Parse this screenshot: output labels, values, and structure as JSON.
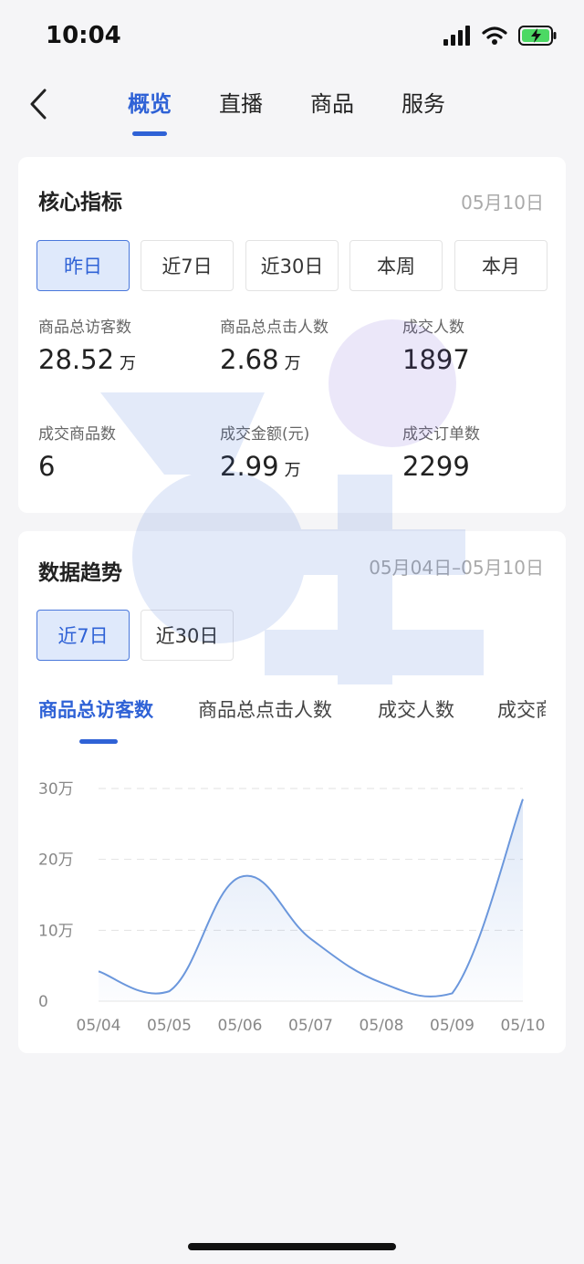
{
  "status_bar": {
    "time": "10:04"
  },
  "nav": {
    "tabs": [
      {
        "label": "概览",
        "active": true
      },
      {
        "label": "直播",
        "active": false
      },
      {
        "label": "商品",
        "active": false
      },
      {
        "label": "服务",
        "active": false
      }
    ]
  },
  "core": {
    "title": "核心指标",
    "date": "05月10日",
    "ranges": [
      "昨日",
      "近7日",
      "近30日",
      "本周",
      "本月"
    ],
    "active_range": 0,
    "metrics": [
      {
        "label": "商品总访客数",
        "value": "28.52",
        "unit": "万"
      },
      {
        "label": "商品总点击人数",
        "value": "2.68",
        "unit": "万"
      },
      {
        "label": "成交人数",
        "value": "1897",
        "unit": ""
      },
      {
        "label": "成交商品数",
        "value": "6",
        "unit": ""
      },
      {
        "label": "成交金额(元)",
        "value": "2.99",
        "unit": "万"
      },
      {
        "label": "成交订单数",
        "value": "2299",
        "unit": ""
      }
    ]
  },
  "trend": {
    "title": "数据趋势",
    "date_range": "05月04日–05月10日",
    "ranges": [
      "近7日",
      "近30日"
    ],
    "active_range": 0,
    "metric_tabs": [
      "商品总访客数",
      "商品总点击人数",
      "成交人数",
      "成交商"
    ],
    "active_metric": 0
  },
  "colors": {
    "accent": "#2f62d6",
    "line": "#6b97dc",
    "active_bg": "#dfe9fb"
  },
  "chart_data": {
    "type": "area",
    "x": [
      "05/04",
      "05/05",
      "05/06",
      "05/07",
      "05/08",
      "05/09",
      "05/10"
    ],
    "series": [
      {
        "values": [
          4.2,
          1.4,
          17.5,
          8.8,
          2.6,
          1.1,
          28.5
        ]
      }
    ],
    "ylim": [
      0,
      30
    ],
    "yticks": [
      0,
      10,
      20,
      30
    ],
    "ytick_labels": [
      "0",
      "10万",
      "20万",
      "30万"
    ],
    "grid": true
  }
}
